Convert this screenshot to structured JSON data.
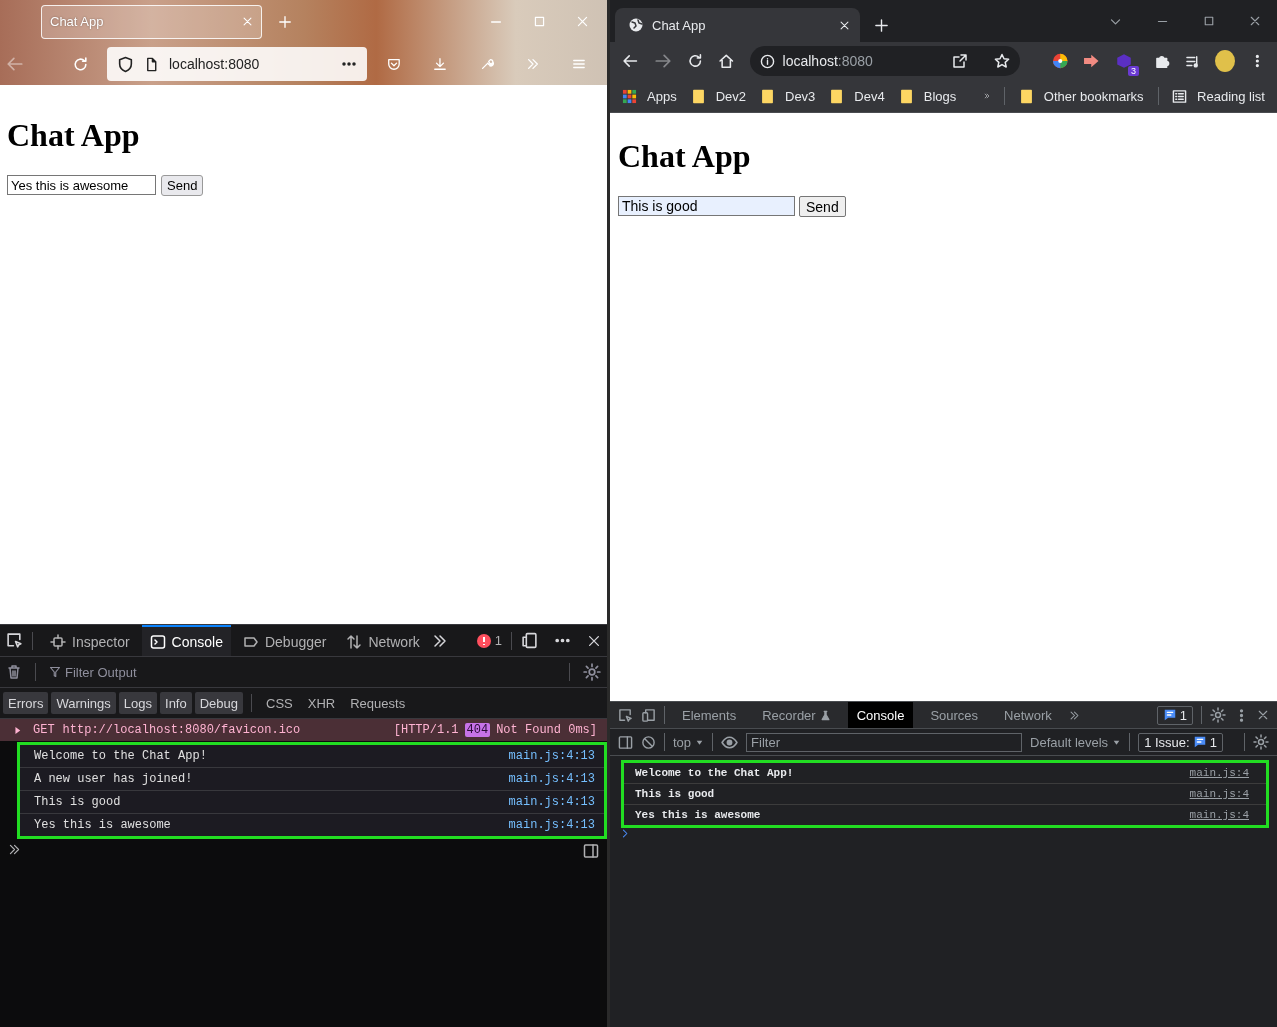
{
  "firefox": {
    "tab": {
      "title": "Chat App"
    },
    "back_enabled": false,
    "address": "localhost:8080",
    "page": {
      "heading": "Chat App",
      "message_input": {
        "value": "Yes this is awesome"
      },
      "send_button": "Send"
    },
    "devtools": {
      "tabs": [
        {
          "label": "Inspector",
          "kind": "inspector",
          "selected": false
        },
        {
          "label": "Console",
          "kind": "console",
          "selected": true
        },
        {
          "label": "Debugger",
          "kind": "debugger",
          "selected": false
        },
        {
          "label": "Network",
          "kind": "network",
          "selected": false
        }
      ],
      "error_count": "1",
      "filter": {
        "placeholder": "Filter Output"
      },
      "levels": [
        {
          "label": "Errors",
          "selected": true
        },
        {
          "label": "Warnings",
          "selected": true
        },
        {
          "label": "Logs",
          "selected": true
        },
        {
          "label": "Info",
          "selected": true
        },
        {
          "label": "Debug",
          "selected": true
        }
      ],
      "request_filters": [
        "CSS",
        "XHR",
        "Requests"
      ],
      "network_error": {
        "method": "GET",
        "url": "http://localhost:8080/favicon.ico",
        "protocol": "[HTTP/1.1",
        "status": "404",
        "status_text": "Not Found 0ms]"
      },
      "logs": {
        "highlighted": true,
        "items": [
          {
            "text": "Welcome to the Chat App!",
            "source": "main.js:4:13"
          },
          {
            "text": "A new user has joined!",
            "source": "main.js:4:13"
          },
          {
            "text": "This is good",
            "source": "main.js:4:13"
          },
          {
            "text": "Yes this is awesome",
            "source": "main.js:4:13"
          }
        ]
      }
    }
  },
  "chrome": {
    "tab": {
      "title": "Chat App"
    },
    "forward_enabled": false,
    "address": {
      "host": "localhost",
      "port": ":8080"
    },
    "extension_badge": "3",
    "bookmarks": [
      {
        "label": "Apps",
        "kind": "apps"
      },
      {
        "label": "Dev2",
        "kind": "folder"
      },
      {
        "label": "Dev3",
        "kind": "folder"
      },
      {
        "label": "Dev4",
        "kind": "folder"
      },
      {
        "label": "Blogs",
        "kind": "folder"
      }
    ],
    "other_bookmarks": "Other bookmarks",
    "reading_list": "Reading list",
    "page": {
      "heading": "Chat App",
      "message_input": {
        "value": "This is good"
      },
      "send_button": "Send"
    },
    "devtools": {
      "tabs": [
        {
          "label": "Elements",
          "kind": "plain",
          "selected": false
        },
        {
          "label": "Recorder",
          "kind": "experimental",
          "selected": false
        },
        {
          "label": "Console",
          "kind": "plain",
          "selected": true
        },
        {
          "label": "Sources",
          "kind": "plain",
          "selected": false
        },
        {
          "label": "Network",
          "kind": "plain",
          "selected": false
        }
      ],
      "issue_badge": "1",
      "context": "top",
      "filter": {
        "placeholder": "Filter"
      },
      "levels": "Default levels",
      "issues": {
        "label": "1 Issue:",
        "count": "1"
      },
      "logs": {
        "highlighted": true,
        "items": [
          {
            "text": "Welcome to the Chat App!",
            "source": "main.js:4"
          },
          {
            "text": "This is good",
            "source": "main.js:4"
          },
          {
            "text": "Yes this is awesome",
            "source": "main.js:4"
          }
        ]
      }
    }
  }
}
